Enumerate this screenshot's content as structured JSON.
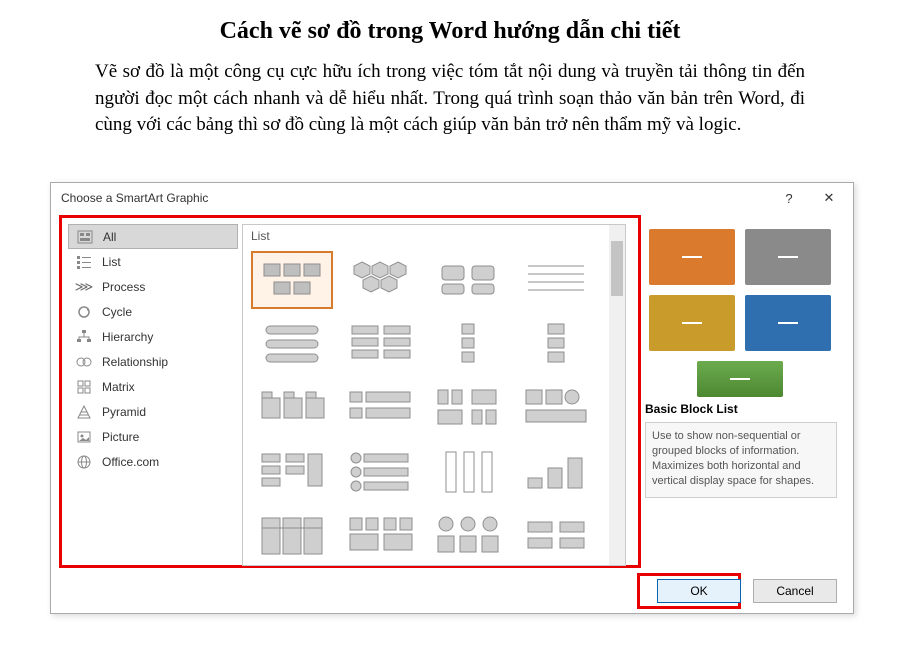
{
  "page": {
    "title": "Cách vẽ sơ đồ trong Word hướng dẫn chi tiết",
    "intro": "Vẽ sơ đồ là một công cụ cực hữu ích trong việc tóm tắt nội dung và truyền tải thông tin đến người đọc một cách nhanh và dễ hiểu nhất. Trong quá trình soạn thảo văn bản trên Word, đi cùng với các bảng thì sơ đồ cùng là một cách giúp văn bản trở nên thẩm mỹ và logic."
  },
  "dialog": {
    "title": "Choose a SmartArt Graphic",
    "help": "?",
    "close": "✕"
  },
  "sidebar": {
    "items": [
      {
        "label": "All"
      },
      {
        "label": "List"
      },
      {
        "label": "Process"
      },
      {
        "label": "Cycle"
      },
      {
        "label": "Hierarchy"
      },
      {
        "label": "Relationship"
      },
      {
        "label": "Matrix"
      },
      {
        "label": "Pyramid"
      },
      {
        "label": "Picture"
      },
      {
        "label": "Office.com"
      }
    ]
  },
  "gallery": {
    "header": "List"
  },
  "preview": {
    "title": "Basic Block List",
    "desc": "Use to show non-sequential or grouped blocks of information. Maximizes both horizontal and vertical display space for shapes.",
    "colors": {
      "orange": "#d97a2d",
      "gray": "#8a8a8a",
      "gold": "#c89b2a",
      "blue": "#2f6fb0",
      "green": "#5b9a3e"
    }
  },
  "buttons": {
    "ok": "OK",
    "cancel": "Cancel"
  }
}
